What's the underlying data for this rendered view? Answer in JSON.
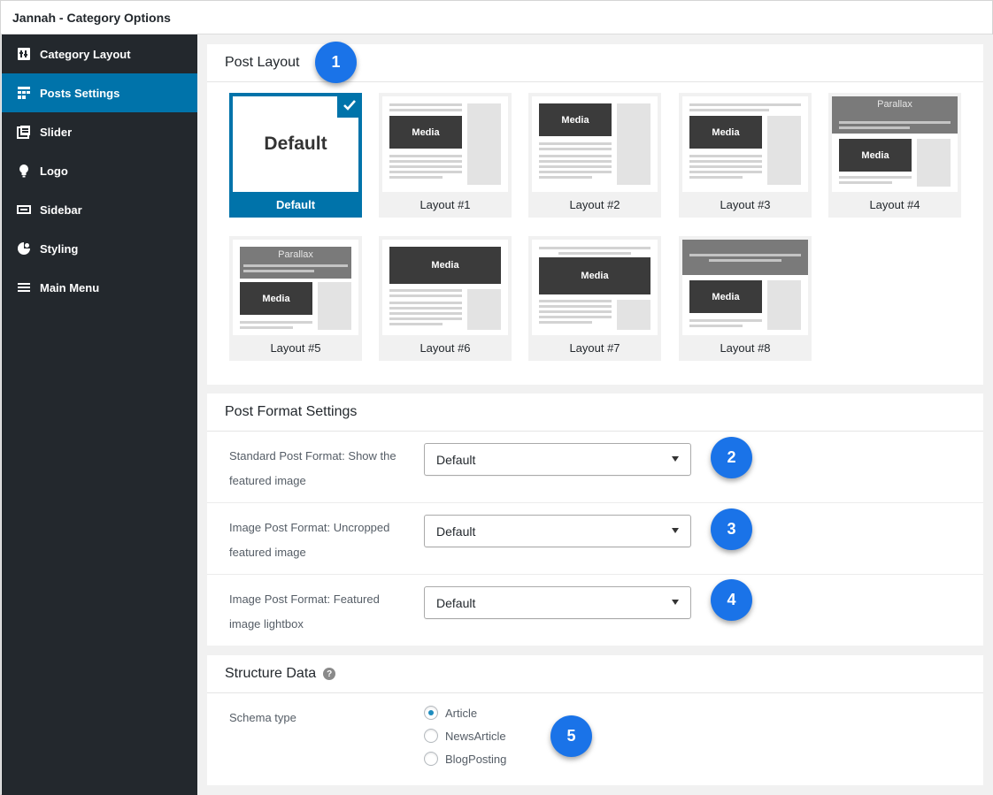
{
  "window": {
    "title": "Jannah - Category Options"
  },
  "sidebar": {
    "items": [
      {
        "label": "Category Layout",
        "icon": "layout-icon"
      },
      {
        "label": "Posts Settings",
        "icon": "posts-grid-icon",
        "active": true
      },
      {
        "label": "Slider",
        "icon": "slider-icon"
      },
      {
        "label": "Logo",
        "icon": "lightbulb-icon"
      },
      {
        "label": "Sidebar",
        "icon": "sidebar-icon"
      },
      {
        "label": "Styling",
        "icon": "palette-icon"
      },
      {
        "label": "Main Menu",
        "icon": "menu-icon"
      }
    ]
  },
  "post_layout": {
    "heading": "Post Layout",
    "default_thumb_text": "Default",
    "media_label": "Media",
    "parallax_label": "Parallax",
    "layouts": [
      {
        "label": "Default",
        "selected": true
      },
      {
        "label": "Layout #1"
      },
      {
        "label": "Layout #2"
      },
      {
        "label": "Layout #3"
      },
      {
        "label": "Layout #4"
      },
      {
        "label": "Layout #5"
      },
      {
        "label": "Layout #6"
      },
      {
        "label": "Layout #7"
      },
      {
        "label": "Layout #8"
      }
    ]
  },
  "post_format": {
    "heading": "Post Format Settings",
    "rows": [
      {
        "label": "Standard Post Format: Show the featured image",
        "value": "Default"
      },
      {
        "label": "Image Post Format: Uncropped featured image",
        "value": "Default"
      },
      {
        "label": "Image Post Format: Featured image lightbox",
        "value": "Default"
      }
    ]
  },
  "structure_data": {
    "heading": "Structure Data",
    "help_glyph": "?",
    "schema_label": "Schema type",
    "options": [
      {
        "label": "Article",
        "checked": true
      },
      {
        "label": "NewsArticle",
        "checked": false
      },
      {
        "label": "BlogPosting",
        "checked": false
      }
    ]
  },
  "badges": [
    "1",
    "2",
    "3",
    "4",
    "5"
  ],
  "colors": {
    "sidebar_bg": "#23282d",
    "active_blue": "#0073aa",
    "badge_blue": "#1a73e8",
    "media_dark": "#3b3b3b"
  }
}
